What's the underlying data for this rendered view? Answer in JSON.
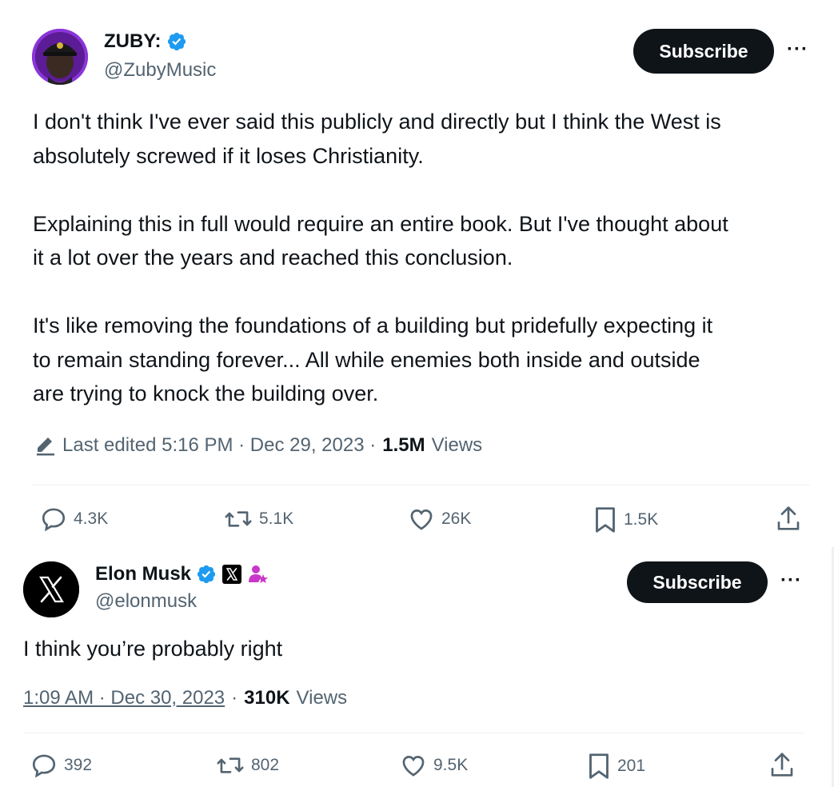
{
  "tweet1": {
    "author_name": "ZUBY:",
    "author_handle": "@ZubyMusic",
    "subscribe_label": "Subscribe",
    "more_label": "···",
    "text": "I don't think I've ever said this publicly and directly but I think the West is\nabsolutely screwed if it loses Christianity.\n\nExplaining this in full would require an entire book. But I've thought about\nit a lot over the years and reached this conclusion.\n\nIt's like removing the foundations of a building but pridefully expecting it\nto remain standing forever... All while enemies both inside and outside\nare trying to knock the building over.",
    "edited_label": "Last edited 5:16 PM · Dec 29, 2023 ·",
    "views_count": "1.5M",
    "views_label": "Views",
    "replies": "4.3K",
    "reposts": "5.1K",
    "likes": "26K",
    "bookmarks": "1.5K"
  },
  "tweet2": {
    "author_name": "Elon Musk",
    "author_handle": "@elonmusk",
    "subscribe_label": "Subscribe",
    "more_label": "···",
    "text": "I think you’re probably right",
    "timestamp": "1:09 AM · Dec 30, 2023",
    "sep": "·",
    "views_count": "310K",
    "views_label": "Views",
    "replies": "392",
    "reposts": "802",
    "likes": "9.5K",
    "bookmarks": "201"
  },
  "colors": {
    "verified": "#1d9bf0",
    "muted": "#536471",
    "text": "#0f1419",
    "subscriber_badge": "#c936c9"
  }
}
